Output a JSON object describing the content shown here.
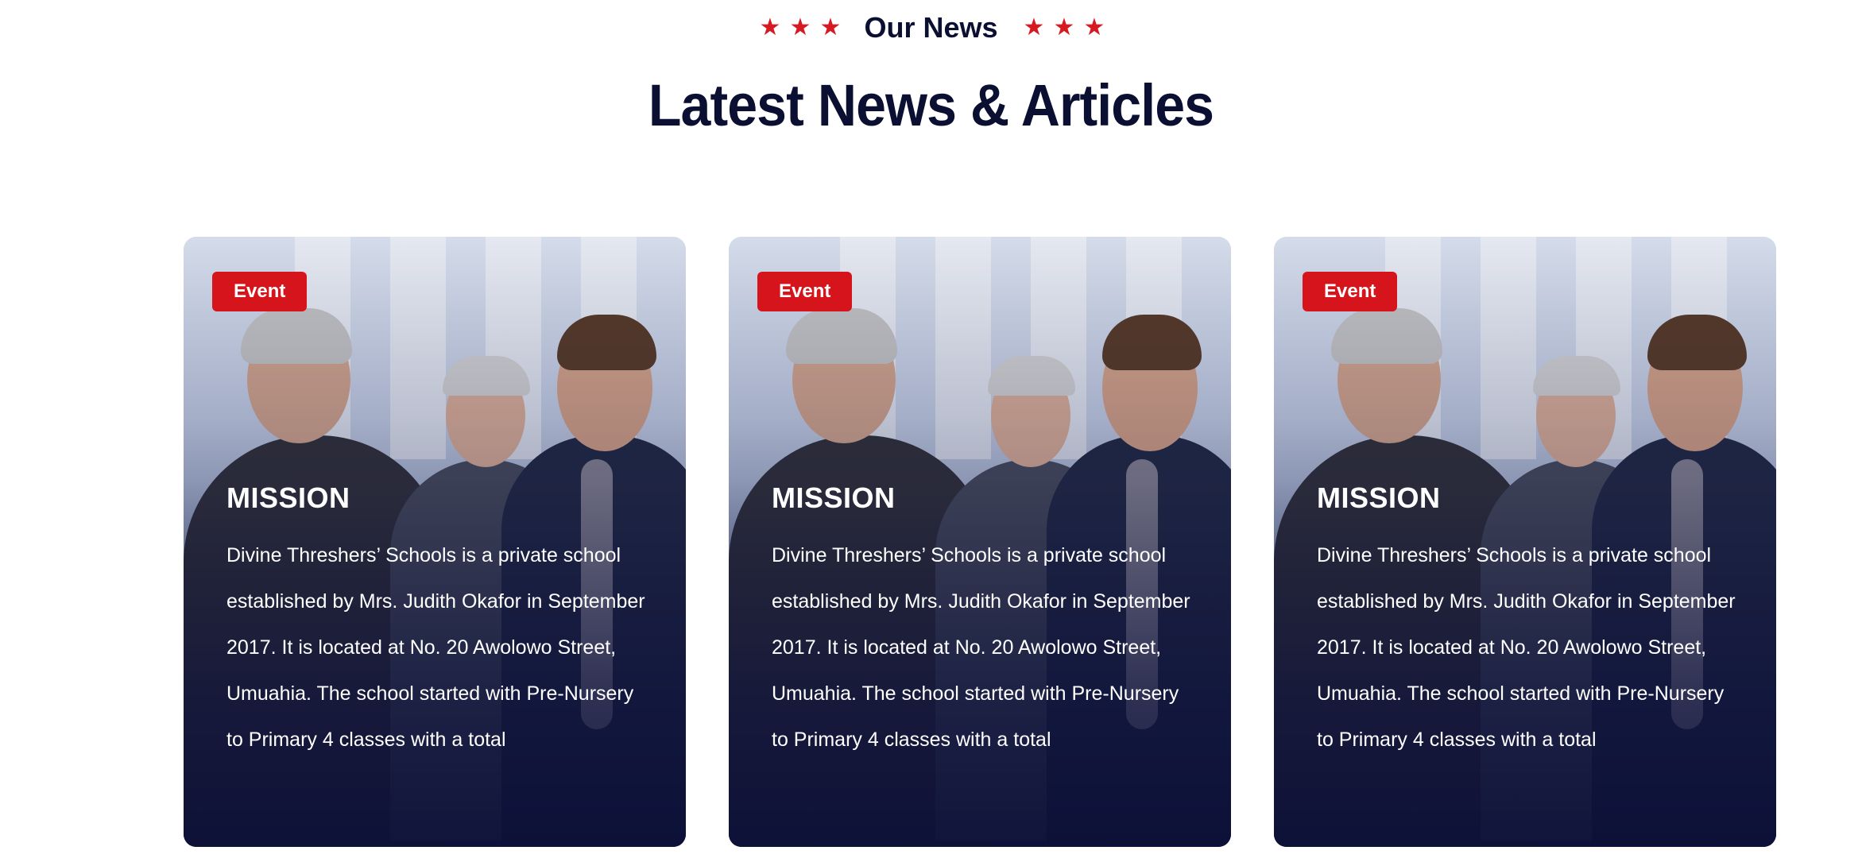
{
  "section": {
    "eyebrow": "Our News",
    "heading": "Latest News & Articles",
    "star_glyph": "★",
    "accent_color": "#d6141c",
    "text_color": "#0b1033"
  },
  "cards": [
    {
      "badge": "Event",
      "title": "MISSION",
      "text": "Divine Threshers’ Schools is a private school established by Mrs. Judith Okafor in September 2017. It is located at No. 20 Awolowo Street, Umuahia. The school started with Pre-Nursery to Primary 4 classes with a total"
    },
    {
      "badge": "Event",
      "title": "MISSION",
      "text": "Divine Threshers’ Schools is a private school established by Mrs. Judith Okafor in September 2017. It is located at No. 20 Awolowo Street, Umuahia. The school started with Pre-Nursery to Primary 4 classes with a total"
    },
    {
      "badge": "Event",
      "title": "MISSION",
      "text": "Divine Threshers’ Schools is a private school established by Mrs. Judith Okafor in September 2017. It is located at No. 20 Awolowo Street, Umuahia. The school started with Pre-Nursery to Primary 4 classes with a total"
    }
  ]
}
